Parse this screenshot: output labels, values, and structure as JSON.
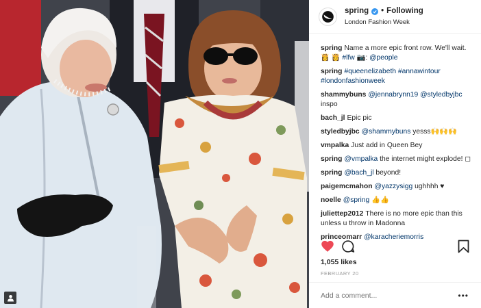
{
  "post": {
    "username": "spring",
    "follow_status": "Following",
    "location": "London Fashion Week",
    "separator": "•",
    "comments": [
      {
        "user": "spring",
        "parts": [
          {
            "t": "Name a more epic front row. We'll wait. 👸 👸 "
          },
          {
            "t": "#lfw",
            "m": true
          },
          {
            "t": " 📷: "
          },
          {
            "t": "@people",
            "m": true
          }
        ]
      },
      {
        "user": "spring",
        "parts": [
          {
            "t": "#queenelizabeth #annawintour #londonfashionweek",
            "m": true
          }
        ]
      },
      {
        "user": "shammybuns",
        "parts": [
          {
            "t": "@jennabrynn19 @styledbyjbc",
            "m": true
          },
          {
            "t": " inspo"
          }
        ]
      },
      {
        "user": "bach_jl",
        "parts": [
          {
            "t": "Epic pic"
          }
        ]
      },
      {
        "user": "styledbyjbc",
        "parts": [
          {
            "t": "@shammybuns",
            "m": true
          },
          {
            "t": " yesss🙌🙌🙌"
          }
        ]
      },
      {
        "user": "vmpalka",
        "parts": [
          {
            "t": "Just add in Queen Bey"
          }
        ]
      },
      {
        "user": "spring",
        "parts": [
          {
            "t": "@vmpalka",
            "m": true
          },
          {
            "t": " the internet might explode! ◻"
          }
        ]
      },
      {
        "user": "spring",
        "parts": [
          {
            "t": "@bach_jl",
            "m": true
          },
          {
            "t": " beyond!"
          }
        ]
      },
      {
        "user": "paigemcmahon",
        "parts": [
          {
            "t": "@yazzysigg",
            "m": true
          },
          {
            "t": " ughhhh ♥"
          }
        ]
      },
      {
        "user": "noelle",
        "parts": [
          {
            "t": "@spring",
            "m": true
          },
          {
            "t": " 👍👍"
          }
        ]
      },
      {
        "user": "juliettep2012",
        "parts": [
          {
            "t": "There is no more epic than this unless u throw in Madonna"
          }
        ]
      },
      {
        "user": "princeomarr",
        "parts": [
          {
            "t": "@karacheriemorris",
            "m": true
          }
        ]
      }
    ],
    "likes": "1,055 likes",
    "date": "FEBRUARY 20",
    "add_comment_placeholder": "Add a comment...",
    "more_label": "•••"
  },
  "icons": {
    "like": "heart-icon",
    "comment": "speech-bubble-icon",
    "save": "bookmark-icon",
    "tagged": "person-icon",
    "verified": "verified-badge-icon"
  },
  "colors": {
    "like_red": "#ed4956",
    "verified_blue": "#3897f0",
    "mention_blue": "#003569",
    "meta_gray": "#999999"
  }
}
